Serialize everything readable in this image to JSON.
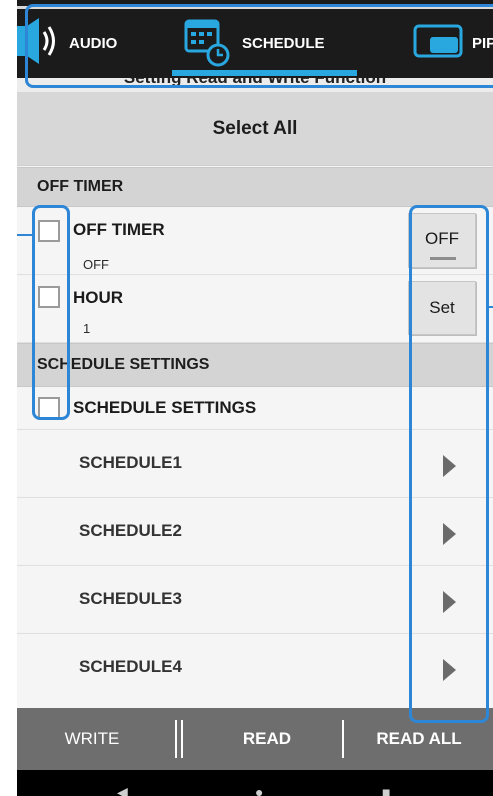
{
  "tabs": [
    {
      "label": "AUDIO",
      "icon": "speaker-icon"
    },
    {
      "label": "SCHEDULE",
      "icon": "calendar-clock-icon",
      "active": true
    },
    {
      "label": "PIP",
      "icon": "pip-icon"
    }
  ],
  "subtitle": "Setting Read and Write Function",
  "select_all": "Select All",
  "off_timer_section": {
    "header": "OFF TIMER",
    "items": [
      {
        "title": "OFF TIMER",
        "value": "OFF",
        "checked": false,
        "button": "OFF"
      },
      {
        "title": "HOUR",
        "value": "1",
        "checked": false,
        "button": "Set"
      }
    ]
  },
  "schedule_section": {
    "header": "SCHEDULE SETTINGS",
    "item_title": "SCHEDULE SETTINGS",
    "checked": false,
    "schedules": [
      "SCHEDULE1",
      "SCHEDULE2",
      "SCHEDULE3",
      "SCHEDULE4"
    ]
  },
  "actions": {
    "write": "WRITE",
    "read": "READ",
    "read_all": "READ ALL"
  },
  "colors": {
    "accent": "#29a8e0",
    "highlight": "#2e86d6",
    "tabbar": "#1b1b1b",
    "actionbar": "#6e6e6e"
  }
}
